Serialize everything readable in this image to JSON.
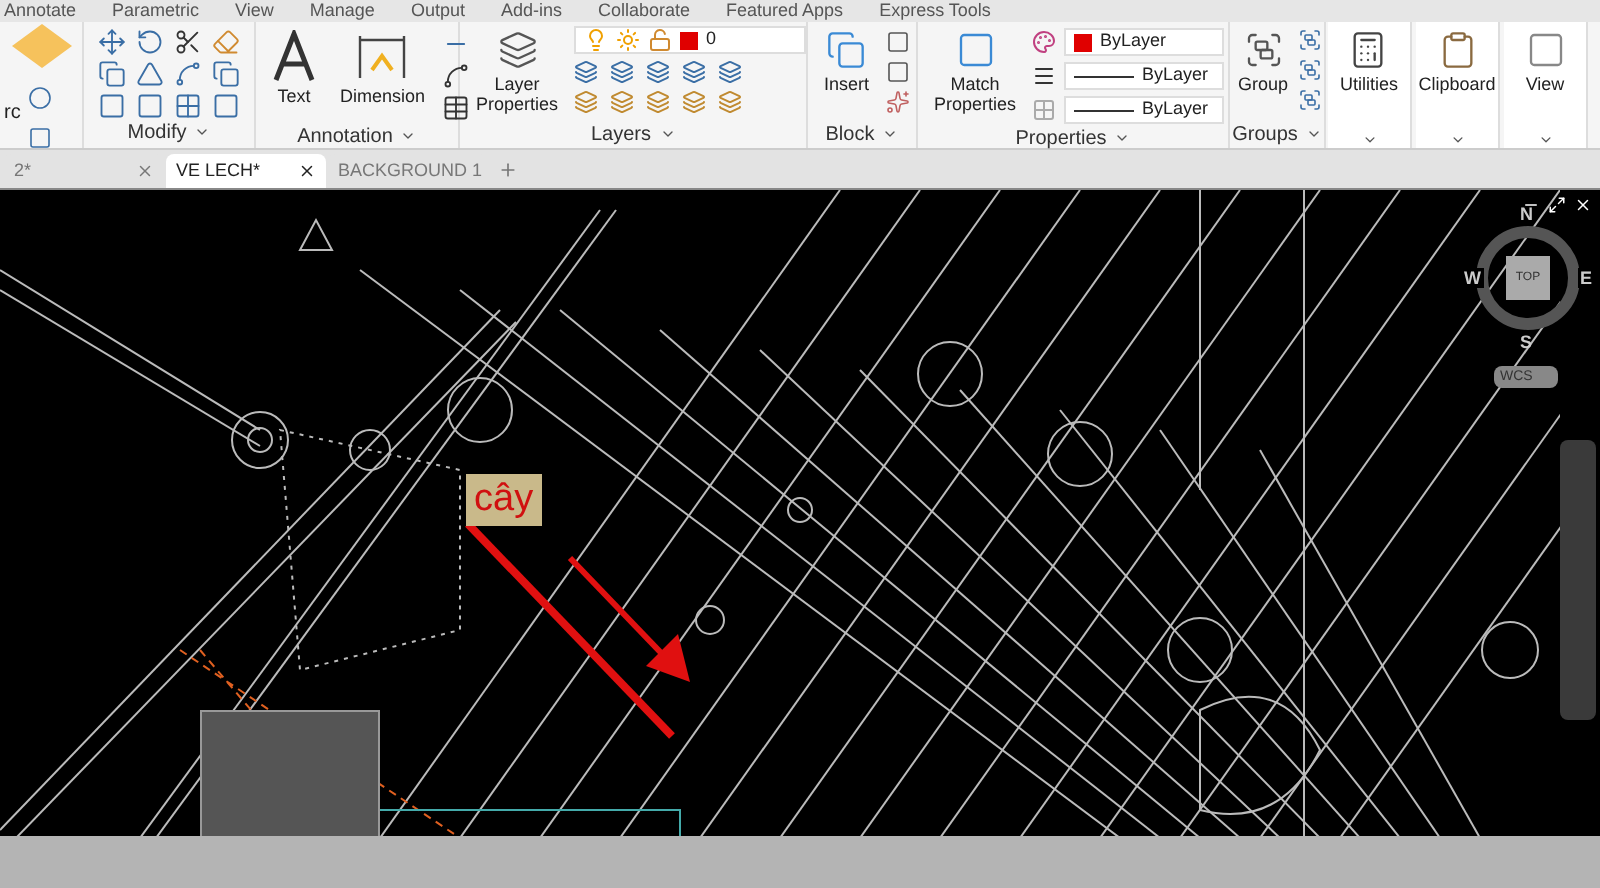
{
  "ribbon_tabs": [
    {
      "label": "Annotate",
      "selected": false
    },
    {
      "label": "Parametric",
      "selected": false
    },
    {
      "label": "View",
      "selected": false
    },
    {
      "label": "Manage",
      "selected": false
    },
    {
      "label": "Output",
      "selected": false
    },
    {
      "label": "Add-ins",
      "selected": false
    },
    {
      "label": "Collaborate",
      "selected": false
    },
    {
      "label": "Featured Apps",
      "selected": false
    },
    {
      "label": "Express Tools",
      "selected": false
    }
  ],
  "draw_panel": {
    "arc_label": "rc"
  },
  "modify_panel": {
    "title": "Modify"
  },
  "annotation_panel": {
    "title": "Annotation",
    "buttons": [
      "Text",
      "Dimension"
    ]
  },
  "layers_panel": {
    "title": "Layers",
    "button": "Layer Properties",
    "current_layer": "0"
  },
  "block_panel": {
    "title": "Block",
    "button": "Insert"
  },
  "properties_panel": {
    "title": "Properties",
    "button": "Match Properties",
    "color_setting": "ByLayer",
    "linetype": "ByLayer",
    "lineweight": "ByLayer"
  },
  "groups_panel": {
    "title": "Groups",
    "button": "Group"
  },
  "tool_buttons": [
    "Utilities",
    "Clipboard",
    "View"
  ],
  "document_tabs": [
    {
      "label": "2*",
      "selected": false
    },
    {
      "label": "VE LECH*",
      "selected": true
    },
    {
      "label": "BACKGROUND 1",
      "selected": false
    }
  ],
  "viewcube": {
    "north": "N",
    "south": "S",
    "east": "E",
    "west": "W",
    "face": "TOP",
    "ucs": "WCS"
  },
  "annotation": {
    "label": "cây"
  }
}
